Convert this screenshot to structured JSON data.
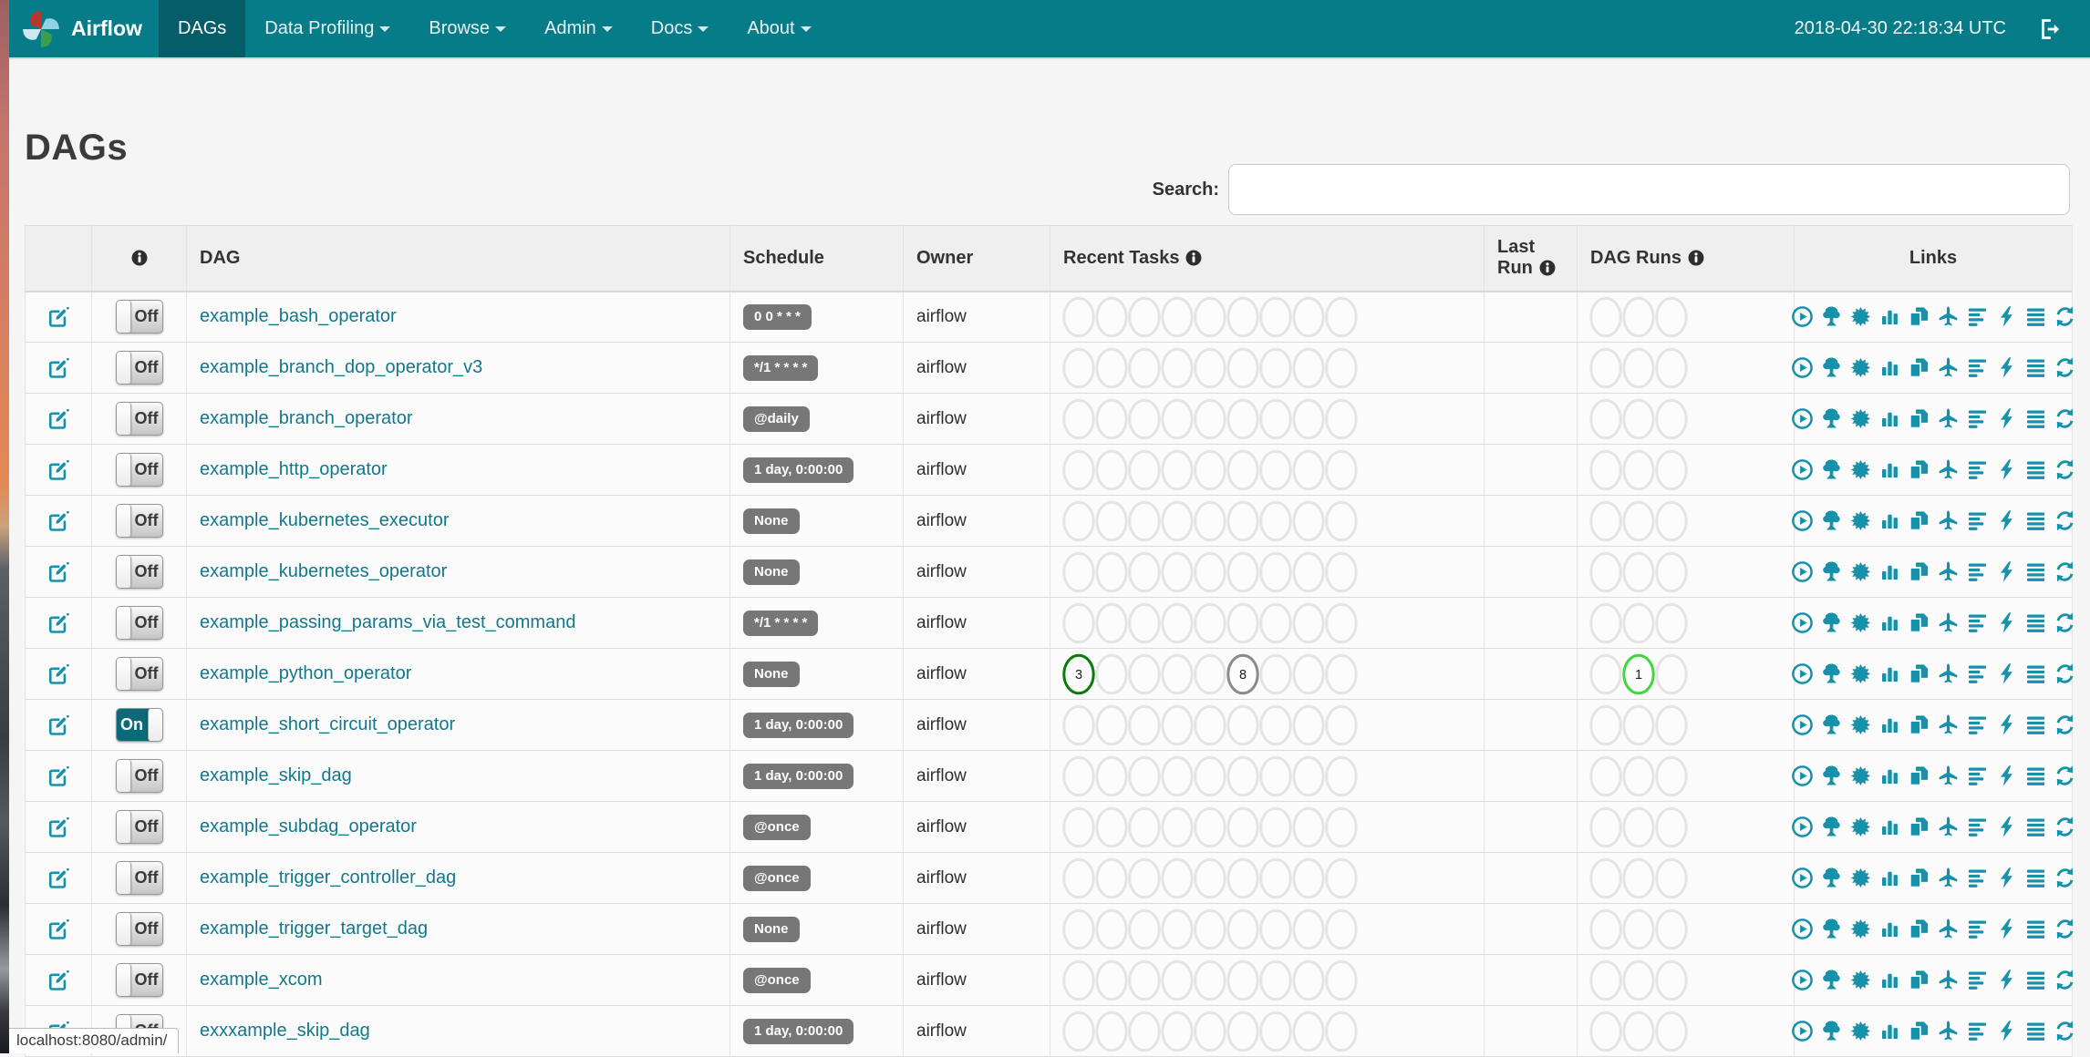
{
  "navbar": {
    "brand": "Airflow",
    "items": [
      {
        "label": "DAGs",
        "active": true,
        "caret": false
      },
      {
        "label": "Data Profiling",
        "active": false,
        "caret": true
      },
      {
        "label": "Browse",
        "active": false,
        "caret": true
      },
      {
        "label": "Admin",
        "active": false,
        "caret": true
      },
      {
        "label": "Docs",
        "active": false,
        "caret": true
      },
      {
        "label": "About",
        "active": false,
        "caret": true
      }
    ],
    "datetime": "2018-04-30 22:18:34 UTC",
    "logout_icon": "logout-icon"
  },
  "page": {
    "title": "DAGs",
    "search_label": "Search:",
    "search_value": "",
    "status_bar": "localhost:8080/admin/"
  },
  "colors": {
    "navbar_teal": "#077c89",
    "navbar_active": "#055d69",
    "link_teal": "#10798c",
    "icon_teal": "#1791a9",
    "badge_gray": "#777777",
    "success": "#0a7a0a",
    "queued": "#8a8a8a",
    "running": "#3fd63f",
    "empty": "#e4e4e4"
  },
  "table": {
    "headers": {
      "info_icon": "info-icon",
      "dag": "DAG",
      "schedule": "Schedule",
      "owner": "Owner",
      "recent_tasks": "Recent Tasks",
      "last_run": "Last Run",
      "dag_runs": "DAG Runs",
      "links": "Links"
    },
    "recent_task_slots": 9,
    "dag_run_slots": 3,
    "links_icons": [
      "play-circle-icon",
      "tree-icon",
      "sun-burst-icon",
      "bar-chart-icon",
      "duplicate-icon",
      "plane-icon",
      "align-left-icon",
      "flash-icon",
      "align-justify-icon",
      "refresh-icon"
    ],
    "rows": [
      {
        "name": "example_bash_operator",
        "schedule": "0 0 * * *",
        "owner": "airflow",
        "toggle": "Off",
        "recent": [],
        "runs": []
      },
      {
        "name": "example_branch_dop_operator_v3",
        "schedule": "*/1 * * * *",
        "owner": "airflow",
        "toggle": "Off",
        "recent": [],
        "runs": []
      },
      {
        "name": "example_branch_operator",
        "schedule": "@daily",
        "owner": "airflow",
        "toggle": "Off",
        "recent": [],
        "runs": []
      },
      {
        "name": "example_http_operator",
        "schedule": "1 day, 0:00:00",
        "owner": "airflow",
        "toggle": "Off",
        "recent": [],
        "runs": []
      },
      {
        "name": "example_kubernetes_executor",
        "schedule": "None",
        "owner": "airflow",
        "toggle": "Off",
        "recent": [],
        "runs": []
      },
      {
        "name": "example_kubernetes_operator",
        "schedule": "None",
        "owner": "airflow",
        "toggle": "Off",
        "recent": [],
        "runs": []
      },
      {
        "name": "example_passing_params_via_test_command",
        "schedule": "*/1 * * * *",
        "owner": "airflow",
        "toggle": "Off",
        "recent": [],
        "runs": []
      },
      {
        "name": "example_python_operator",
        "schedule": "None",
        "owner": "airflow",
        "toggle": "Off",
        "recent": [
          {
            "index": 0,
            "count": 3,
            "state": "success"
          },
          {
            "index": 5,
            "count": 8,
            "state": "queued"
          }
        ],
        "runs": [
          {
            "index": 1,
            "count": 1,
            "state": "running"
          }
        ]
      },
      {
        "name": "example_short_circuit_operator",
        "schedule": "1 day, 0:00:00",
        "owner": "airflow",
        "toggle": "On",
        "recent": [],
        "runs": []
      },
      {
        "name": "example_skip_dag",
        "schedule": "1 day, 0:00:00",
        "owner": "airflow",
        "toggle": "Off",
        "recent": [],
        "runs": []
      },
      {
        "name": "example_subdag_operator",
        "schedule": "@once",
        "owner": "airflow",
        "toggle": "Off",
        "recent": [],
        "runs": []
      },
      {
        "name": "example_trigger_controller_dag",
        "schedule": "@once",
        "owner": "airflow",
        "toggle": "Off",
        "recent": [],
        "runs": []
      },
      {
        "name": "example_trigger_target_dag",
        "schedule": "None",
        "owner": "airflow",
        "toggle": "Off",
        "recent": [],
        "runs": []
      },
      {
        "name": "example_xcom",
        "schedule": "@once",
        "owner": "airflow",
        "toggle": "Off",
        "recent": [],
        "runs": []
      },
      {
        "name": "exxxample_skip_dag",
        "schedule": "1 day, 0:00:00",
        "owner": "airflow",
        "toggle": "Off",
        "recent": [],
        "runs": []
      }
    ]
  }
}
